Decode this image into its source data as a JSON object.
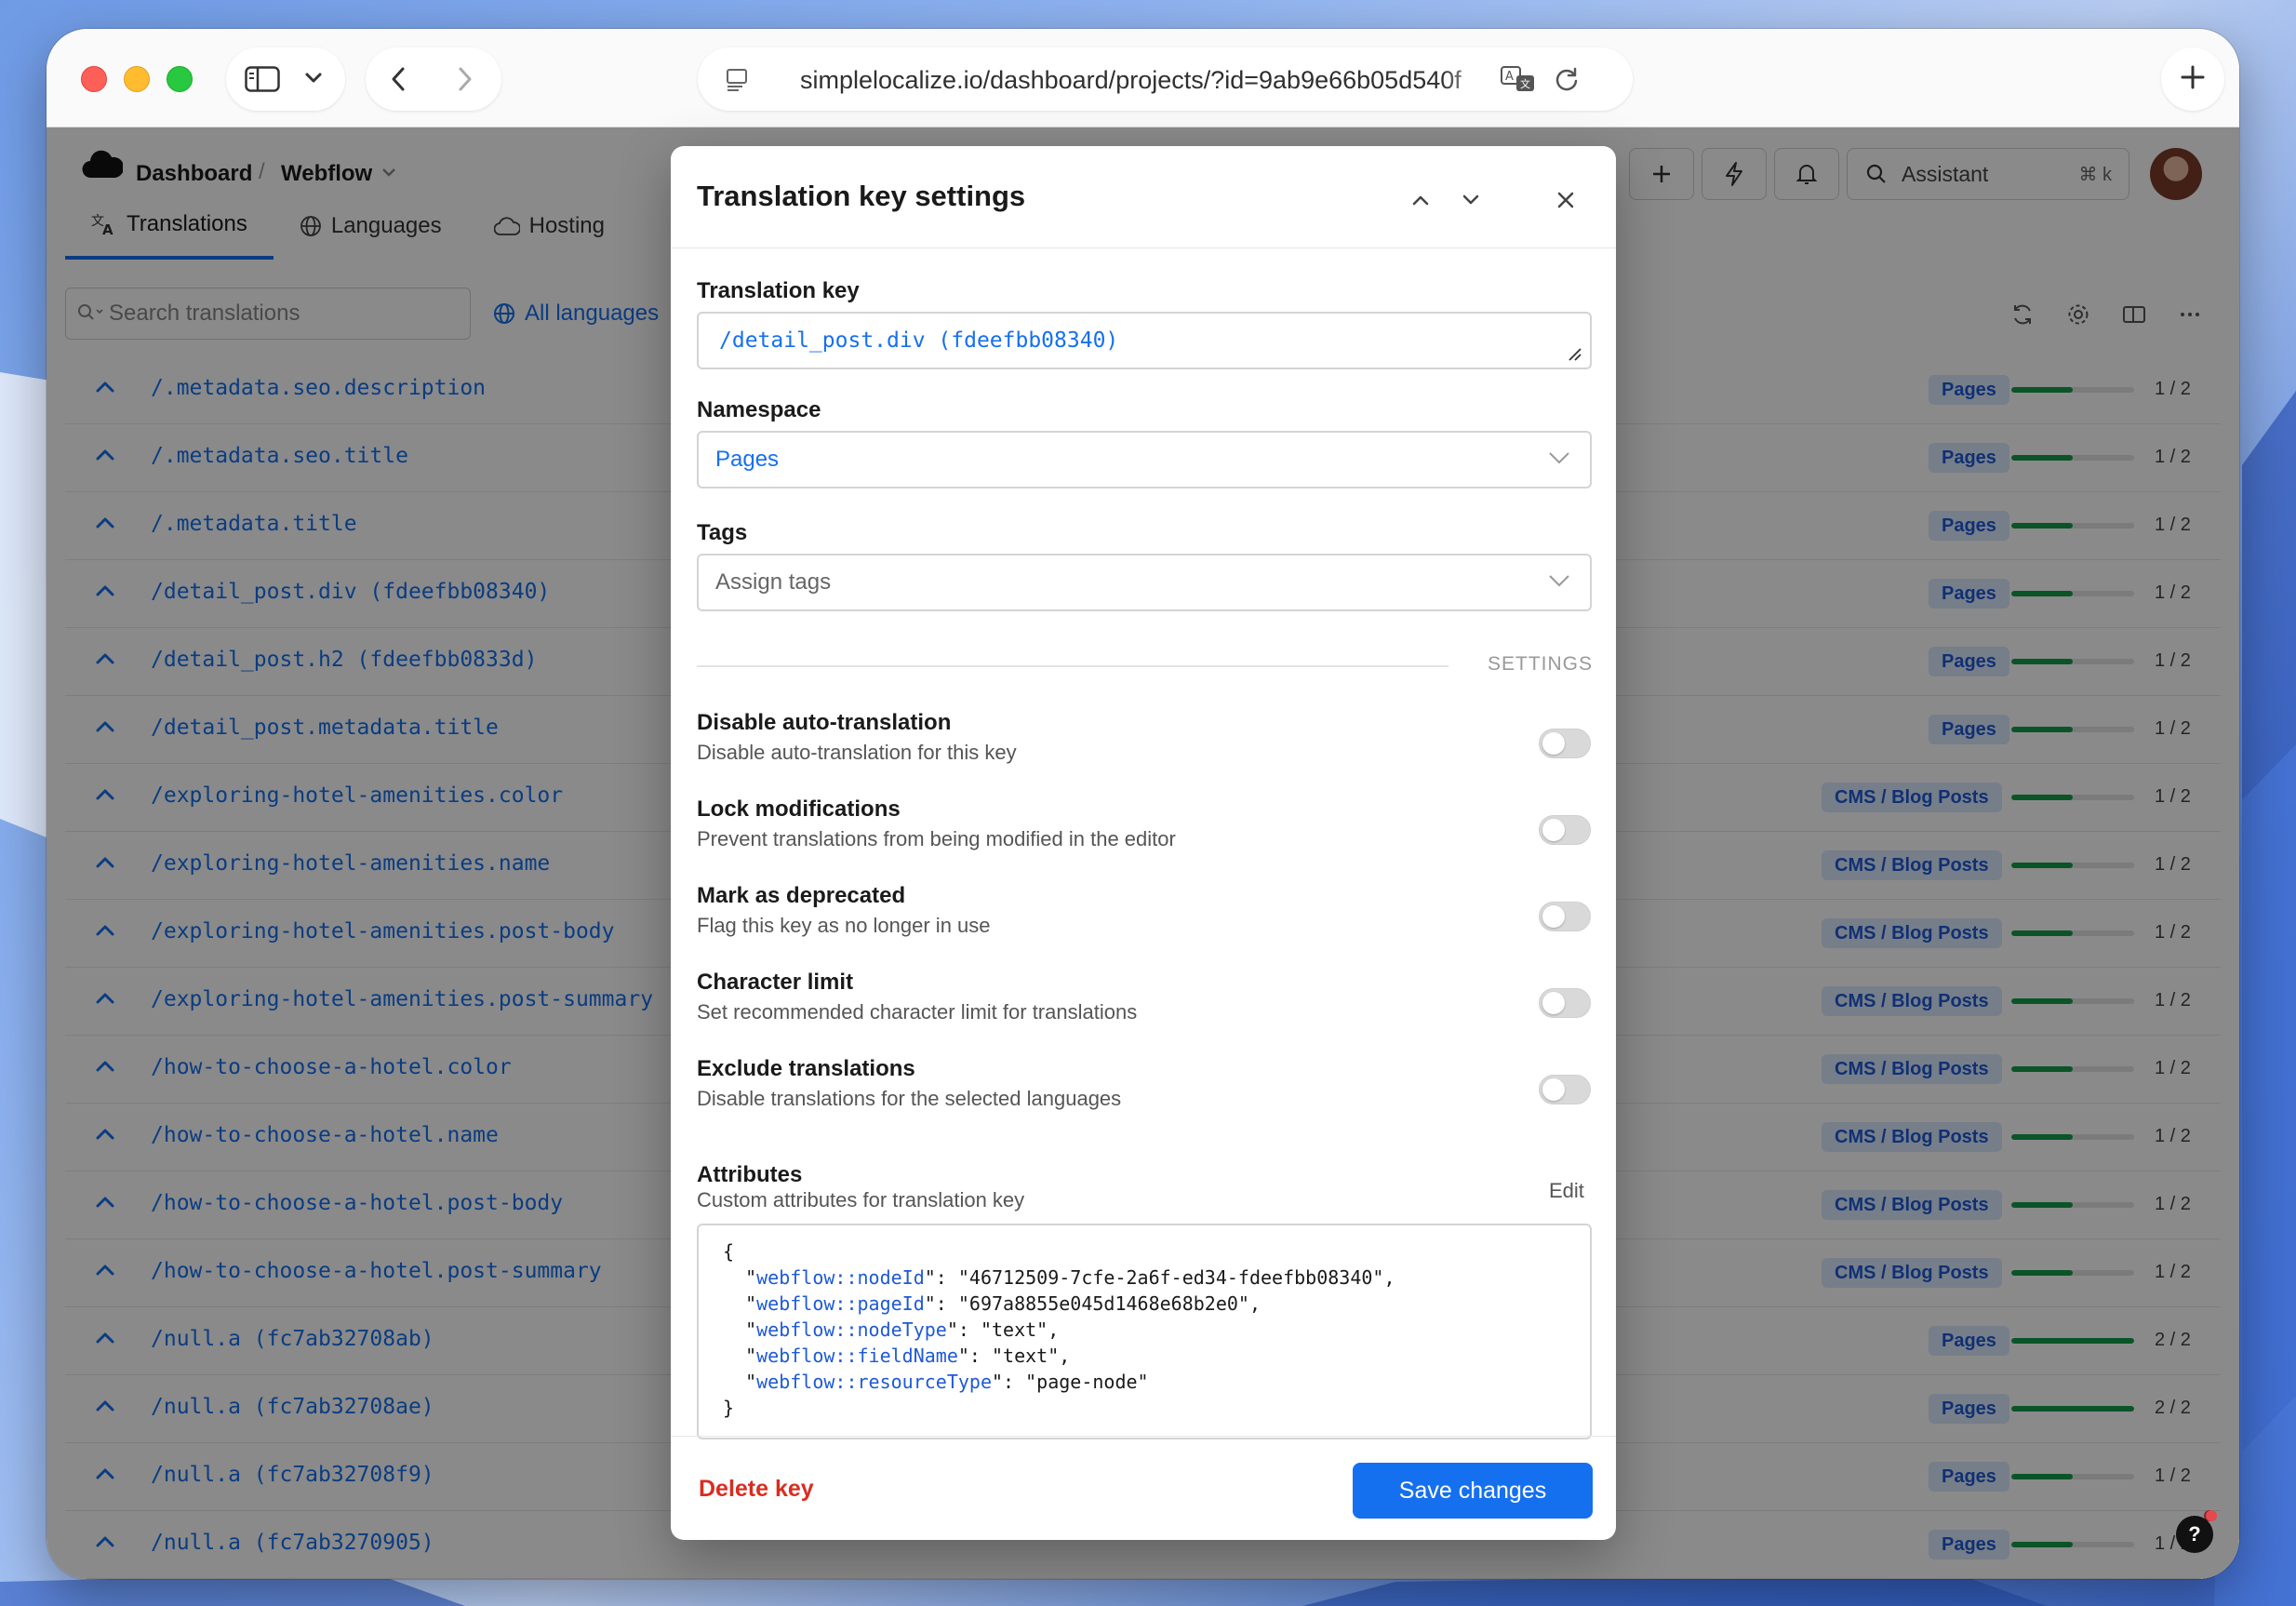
{
  "browser": {
    "url": "simplelocalize.io/dashboard/projects/?id=9ab9e66b05d540f"
  },
  "app": {
    "breadcrumb": {
      "root": "Dashboard",
      "project": "Webflow"
    },
    "tabs": [
      {
        "label": "Translations",
        "icon": "translate-icon",
        "active": true
      },
      {
        "label": "Languages",
        "icon": "globe-icon",
        "active": false
      },
      {
        "label": "Hosting",
        "icon": "cloud-icon",
        "active": false
      }
    ],
    "assistant": {
      "label": "Assistant",
      "shortcut": "⌘ k"
    },
    "search_placeholder": "Search translations",
    "language_filter": "All languages",
    "rows": [
      {
        "key": "/.metadata.seo.description",
        "namespace": "Pages",
        "progress": 0.5,
        "fraction": "1 / 2"
      },
      {
        "key": "/.metadata.seo.title",
        "namespace": "Pages",
        "progress": 0.5,
        "fraction": "1 / 2"
      },
      {
        "key": "/.metadata.title",
        "namespace": "Pages",
        "progress": 0.5,
        "fraction": "1 / 2"
      },
      {
        "key": "/detail_post.div (fdeefbb08340)",
        "namespace": "Pages",
        "progress": 0.5,
        "fraction": "1 / 2"
      },
      {
        "key": "/detail_post.h2 (fdeefbb0833d)",
        "namespace": "Pages",
        "progress": 0.5,
        "fraction": "1 / 2"
      },
      {
        "key": "/detail_post.metadata.title",
        "namespace": "Pages",
        "progress": 0.5,
        "fraction": "1 / 2"
      },
      {
        "key": "/exploring-hotel-amenities.color",
        "namespace": "CMS / Blog Posts",
        "progress": 0.5,
        "fraction": "1 / 2"
      },
      {
        "key": "/exploring-hotel-amenities.name",
        "namespace": "CMS / Blog Posts",
        "progress": 0.5,
        "fraction": "1 / 2"
      },
      {
        "key": "/exploring-hotel-amenities.post-body",
        "namespace": "CMS / Blog Posts",
        "progress": 0.5,
        "fraction": "1 / 2"
      },
      {
        "key": "/exploring-hotel-amenities.post-summary",
        "namespace": "CMS / Blog Posts",
        "progress": 0.5,
        "fraction": "1 / 2"
      },
      {
        "key": "/how-to-choose-a-hotel.color",
        "namespace": "CMS / Blog Posts",
        "progress": 0.5,
        "fraction": "1 / 2"
      },
      {
        "key": "/how-to-choose-a-hotel.name",
        "namespace": "CMS / Blog Posts",
        "progress": 0.5,
        "fraction": "1 / 2"
      },
      {
        "key": "/how-to-choose-a-hotel.post-body",
        "namespace": "CMS / Blog Posts",
        "progress": 0.5,
        "fraction": "1 / 2"
      },
      {
        "key": "/how-to-choose-a-hotel.post-summary",
        "namespace": "CMS / Blog Posts",
        "progress": 0.5,
        "fraction": "1 / 2"
      },
      {
        "key": "/null.a (fc7ab32708ab)",
        "namespace": "Pages",
        "progress": 1.0,
        "fraction": "2 / 2"
      },
      {
        "key": "/null.a (fc7ab32708ae)",
        "namespace": "Pages",
        "progress": 1.0,
        "fraction": "2 / 2"
      },
      {
        "key": "/null.a (fc7ab32708f9)",
        "namespace": "Pages",
        "progress": 0.5,
        "fraction": "1 / 2"
      },
      {
        "key": "/null.a (fc7ab3270905)",
        "namespace": "Pages",
        "progress": 0.5,
        "fraction": "1 / 2"
      }
    ]
  },
  "modal": {
    "title": "Translation key settings",
    "key_label": "Translation key",
    "key_value": "/detail_post.div (fdeefbb08340)",
    "namespace_label": "Namespace",
    "namespace_value": "Pages",
    "tags_label": "Tags",
    "tags_placeholder": "Assign tags",
    "settings_heading": "SETTINGS",
    "settings": [
      {
        "title": "Disable auto-translation",
        "desc": "Disable auto-translation for this key",
        "enabled": false
      },
      {
        "title": "Lock modifications",
        "desc": "Prevent translations from being modified in the editor",
        "enabled": false
      },
      {
        "title": "Mark as deprecated",
        "desc": "Flag this key as no longer in use",
        "enabled": false
      },
      {
        "title": "Character limit",
        "desc": "Set recommended character limit for translations",
        "enabled": false
      },
      {
        "title": "Exclude translations",
        "desc": "Disable translations for the selected languages",
        "enabled": false
      }
    ],
    "attributes_label": "Attributes",
    "attributes_desc": "Custom attributes for translation key",
    "edit_label": "Edit",
    "attributes": [
      {
        "key": "webflow::nodeId",
        "value": "46712509-7cfe-2a6f-ed34-fdeefbb08340"
      },
      {
        "key": "webflow::pageId",
        "value": "697a8855e045d1468e68b2e0"
      },
      {
        "key": "webflow::nodeType",
        "value": "text"
      },
      {
        "key": "webflow::fieldName",
        "value": "text"
      },
      {
        "key": "webflow::resourceType",
        "value": "page-node"
      }
    ],
    "delete_label": "Delete key",
    "save_label": "Save changes"
  },
  "colors": {
    "accent": "#1570ef",
    "danger": "#d92d20",
    "progress": "#159b4b",
    "badge_bg": "#dbe9fe"
  }
}
